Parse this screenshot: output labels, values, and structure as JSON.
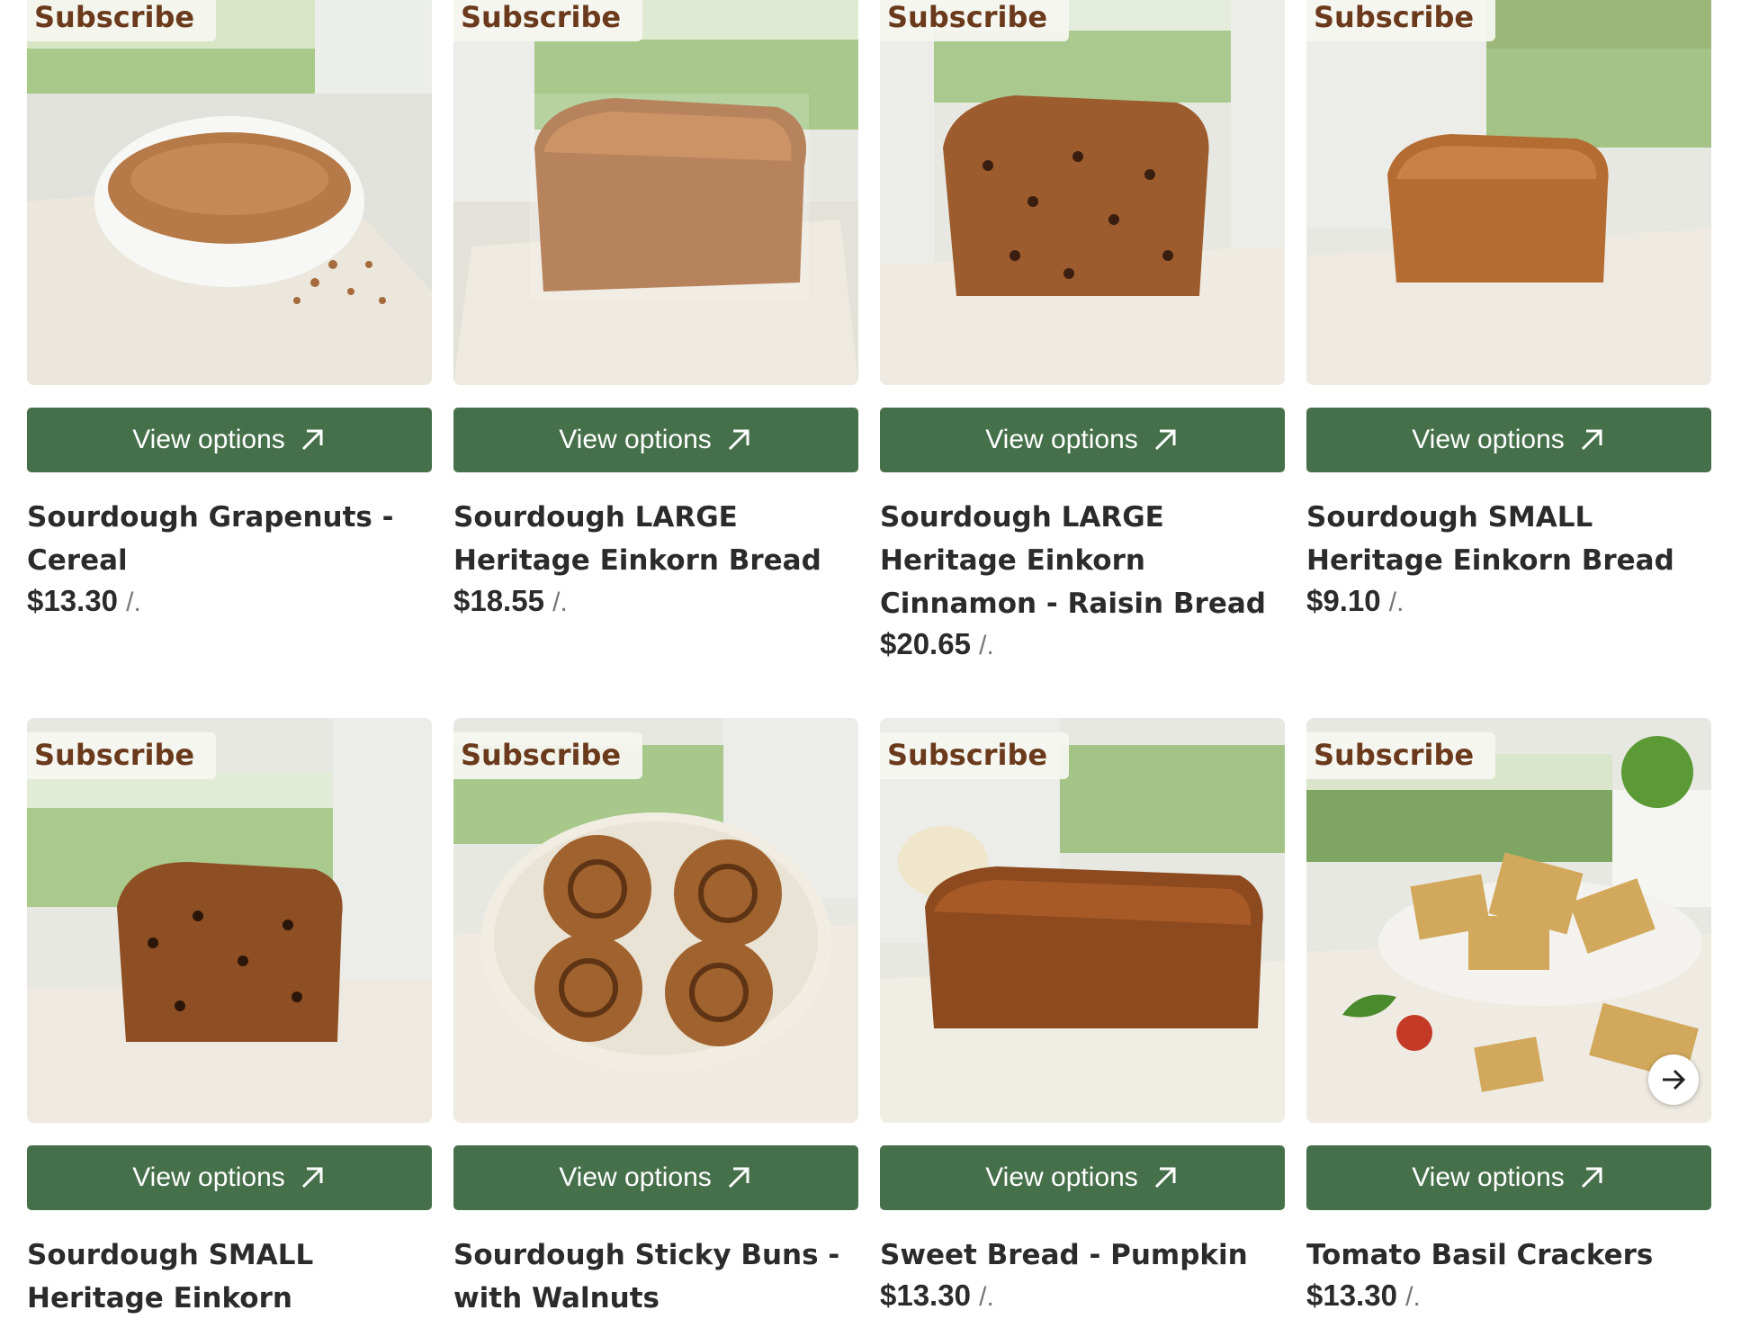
{
  "colors": {
    "button_bg": "#46704a",
    "badge_text": "#6b3a1c",
    "title_text": "#2b2b2b"
  },
  "products": [
    {
      "badge": "Subscribe",
      "button": "View options",
      "title": "Sourdough Grapenuts - Cereal",
      "price": "$13.30",
      "unit": "/.",
      "image": "grapenuts-cereal-bowl"
    },
    {
      "badge": "Subscribe",
      "button": "View options",
      "title": "Sourdough LARGE Heritage Einkorn Bread",
      "price": "$18.55",
      "unit": "/.",
      "image": "large-einkorn-loaf"
    },
    {
      "badge": "Subscribe",
      "button": "View options",
      "title": "Sourdough LARGE Heritage Einkorn Cinnamon - Raisin Bread",
      "price": "$20.65",
      "unit": "/.",
      "image": "large-cinnamon-raisin-loaf"
    },
    {
      "badge": "Subscribe",
      "button": "View options",
      "title": "Sourdough SMALL Heritage Einkorn Bread",
      "price": "$9.10",
      "unit": "/.",
      "image": "small-einkorn-loaf"
    },
    {
      "badge": "Subscribe",
      "button": "View options",
      "title": "Sourdough SMALL Heritage Einkorn Cinnamon - Raisin",
      "price": "",
      "unit": "",
      "image": "small-cinnamon-raisin-loaf"
    },
    {
      "badge": "Subscribe",
      "button": "View options",
      "title": "Sourdough Sticky Buns - with Walnuts",
      "price": "",
      "unit": "",
      "image": "sticky-buns-walnuts"
    },
    {
      "badge": "Subscribe",
      "button": "View options",
      "title": "Sweet Bread - Pumpkin",
      "price": "$13.30",
      "unit": "/.",
      "image": "pumpkin-sweet-bread"
    },
    {
      "badge": "Subscribe",
      "button": "View options",
      "title": "Tomato Basil Crackers",
      "price": "$13.30",
      "unit": "/.",
      "image": "tomato-basil-crackers"
    }
  ],
  "carousel": {
    "next_icon": "arrow-right-icon"
  }
}
